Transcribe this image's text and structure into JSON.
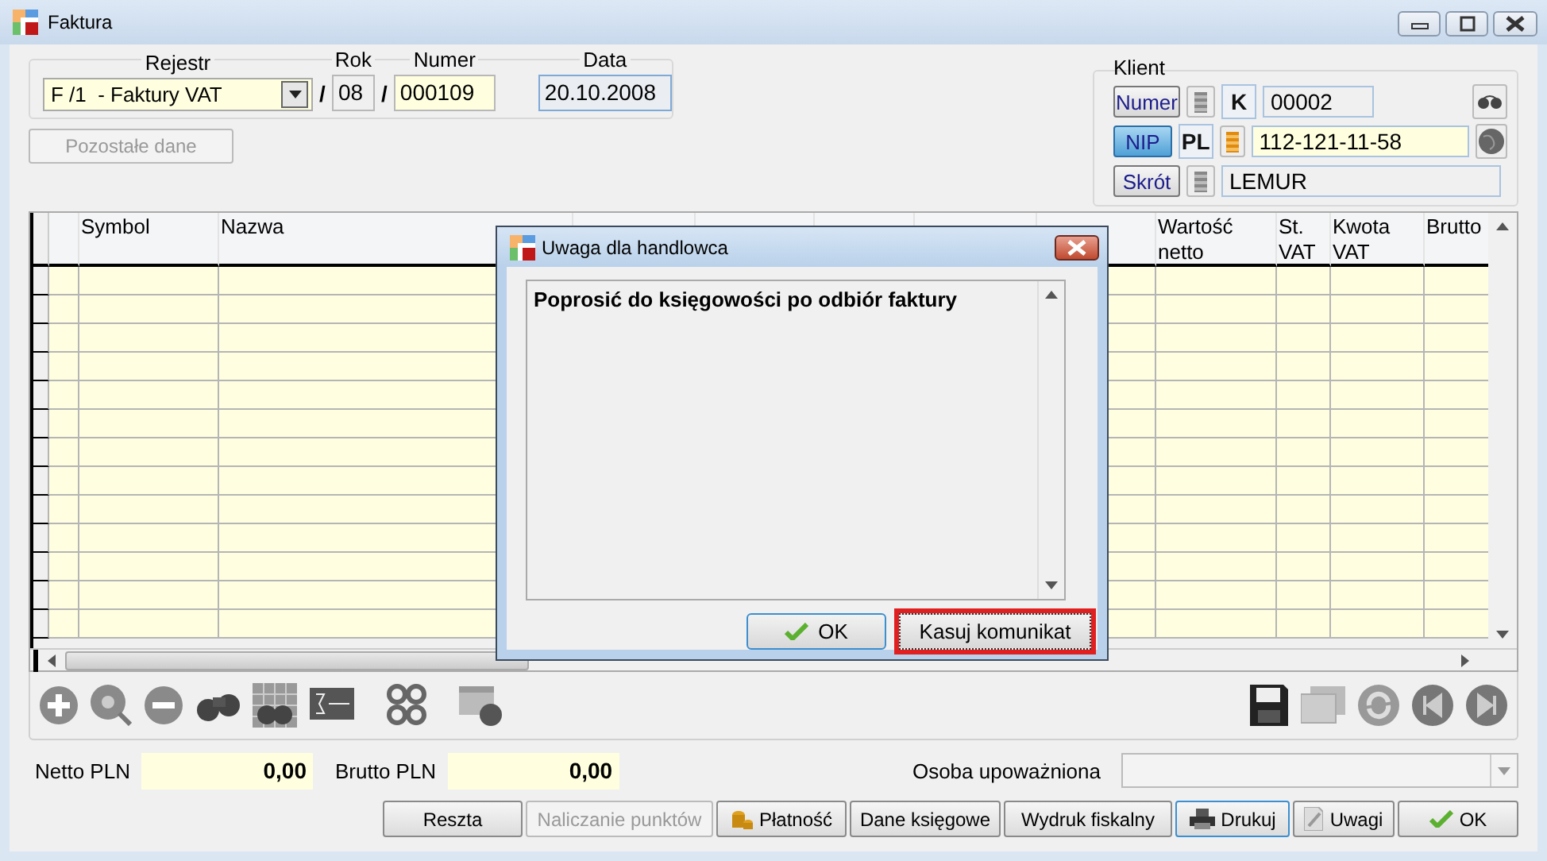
{
  "window": {
    "title": "Faktura"
  },
  "header": {
    "rejestr": {
      "label": "Rejestr",
      "value": "F /1  - Faktury VAT"
    },
    "rok": {
      "label": "Rok",
      "value": "08"
    },
    "separator": "/",
    "numer": {
      "label": "Numer",
      "value": "000109"
    },
    "data": {
      "label": "Data",
      "value": "20.10.2008"
    },
    "other_button": {
      "label": "Pozostałe dane",
      "disabled": true
    }
  },
  "client": {
    "title": "Klient",
    "rows": [
      {
        "kind": "number",
        "button": "Numer",
        "selected": false,
        "prefix": "K",
        "value": "00002"
      },
      {
        "kind": "nip",
        "button": "NIP",
        "selected": true,
        "prefix": "PL",
        "value": "112-121-11-58"
      },
      {
        "kind": "short",
        "button": "Skrót",
        "selected": false,
        "value": "LEMUR"
      }
    ]
  },
  "table": {
    "columns": [
      "Symbol",
      "Nazwa",
      "Wartość netto",
      "St. VAT",
      "Kwota VAT",
      "Brutto"
    ]
  },
  "dialog": {
    "title": "Uwaga dla handlowca",
    "message": "Poprosić do księgowości po odbiór faktury",
    "buttons": [
      {
        "label": "OK",
        "kind": "ok",
        "focused": false
      },
      {
        "label": "Kasuj komunikat",
        "kind": "plain",
        "focused": true
      }
    ]
  },
  "totals": [
    {
      "label": "Netto PLN",
      "value": "0,00"
    },
    {
      "label": "Brutto PLN",
      "value": "0,00"
    }
  ],
  "authorized": {
    "label": "Osoba upoważniona"
  },
  "buttons": [
    {
      "label": "Reszta",
      "kind": "plain",
      "disabled": false,
      "default": false
    },
    {
      "label": "Naliczanie punktów",
      "kind": "plain",
      "disabled": true,
      "default": false
    },
    {
      "label": "Płatność",
      "kind": "coins",
      "disabled": false,
      "default": false
    },
    {
      "label": "Dane księgowe",
      "kind": "plain",
      "disabled": false,
      "default": false
    },
    {
      "label": "Wydruk fiskalny",
      "kind": "plain",
      "disabled": false,
      "default": false
    },
    {
      "label": "Drukuj",
      "kind": "printer",
      "disabled": false,
      "default": true
    },
    {
      "label": "Uwagi",
      "kind": "note",
      "disabled": false,
      "default": false
    },
    {
      "label": "OK",
      "kind": "ok",
      "disabled": false,
      "default": false
    }
  ]
}
